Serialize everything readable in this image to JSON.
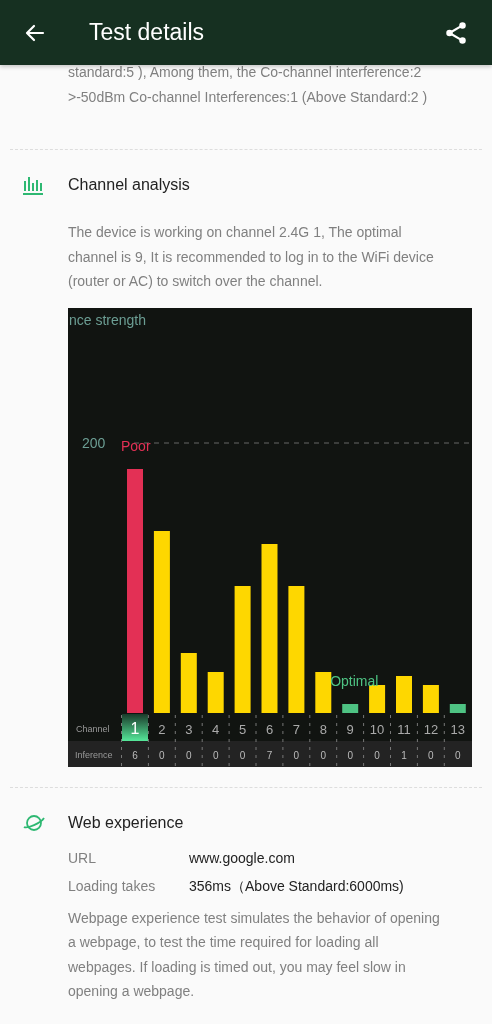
{
  "header": {
    "title": "Test details"
  },
  "intro_lines": [
    "standard:5 ), Among them, the Co-channel interference:2",
    ">-50dBm Co-channel Interferences:1 (Above Standard:2 )"
  ],
  "channel_analysis": {
    "title": "Channel analysis",
    "description": "The device is working on channel 2.4G 1, The optimal channel is 9, It is recommended to log in to the WiFi device (router or AC) to switch over the channel.",
    "chart": {
      "title": "nce strength",
      "threshold_label": "Poor",
      "optimal_label": "Optimal",
      "row_labels": [
        "Channel",
        "Inference"
      ],
      "threshold_value": "200",
      "channels": [
        {
          "label": "1",
          "inference": "6",
          "color": "#e33055",
          "selected": true
        },
        {
          "label": "2",
          "inference": "0",
          "color": "#fed700",
          "selected": false
        },
        {
          "label": "3",
          "inference": "0",
          "color": "#fed700",
          "selected": false
        },
        {
          "label": "4",
          "inference": "0",
          "color": "#fed700",
          "selected": false
        },
        {
          "label": "5",
          "inference": "0",
          "color": "#fed700",
          "selected": false
        },
        {
          "label": "6",
          "inference": "7",
          "color": "#fed700",
          "selected": false
        },
        {
          "label": "7",
          "inference": "0",
          "color": "#fed700",
          "selected": false
        },
        {
          "label": "8",
          "inference": "0",
          "color": "#fed700",
          "selected": false
        },
        {
          "label": "9",
          "inference": "0",
          "color": "#4ec383",
          "selected": false
        },
        {
          "label": "10",
          "inference": "0",
          "color": "#fed700",
          "selected": false
        },
        {
          "label": "11",
          "inference": "1",
          "color": "#fed700",
          "selected": false
        },
        {
          "label": "12",
          "inference": "0",
          "color": "#fed700",
          "selected": false
        },
        {
          "label": "13",
          "inference": "0",
          "color": "#4ec383",
          "selected": false
        }
      ]
    }
  },
  "web_experience": {
    "title": "Web experience",
    "rows": [
      {
        "label": "URL",
        "value": "www.google.com"
      },
      {
        "label": "Loading takes",
        "value": "356ms（Above Standard:6000ms)"
      }
    ],
    "description": "Webpage experience test simulates the behavior of opening a webpage, to test the time required for loading all webpages. If loading is timed out, you may feel slow in opening a webpage."
  }
}
